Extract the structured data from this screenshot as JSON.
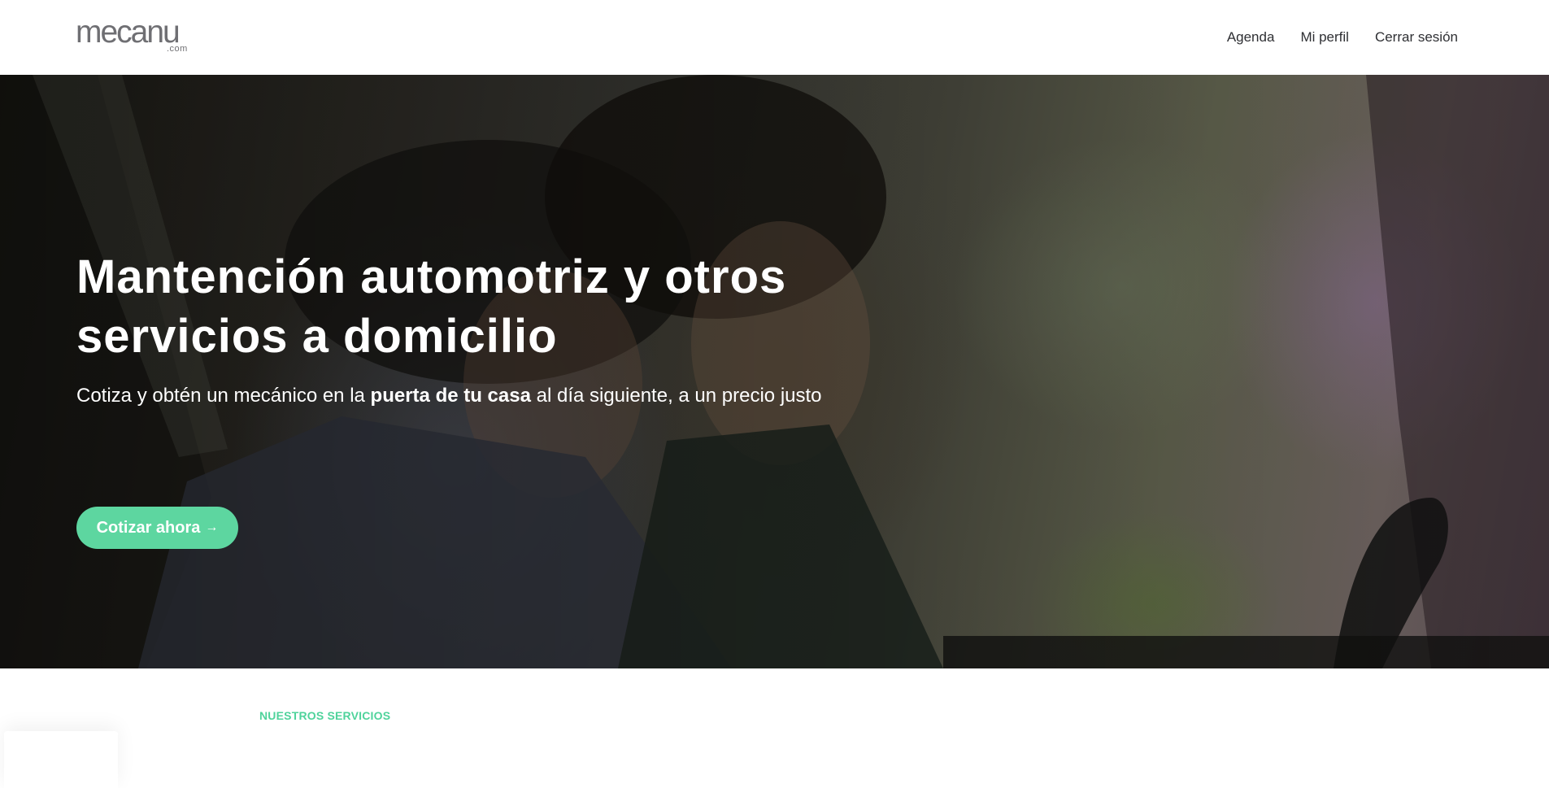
{
  "header": {
    "logo_main": "mecanu",
    "logo_sub": ".com",
    "nav": [
      {
        "label": "Agenda"
      },
      {
        "label": "Mi perfil"
      },
      {
        "label": "Cerrar sesión"
      }
    ]
  },
  "hero": {
    "title": "Mantención automotriz y otros servicios a domicilio",
    "subtitle_before": "Cotiza y obtén un mecánico en la ",
    "subtitle_bold": "puerta de tu casa",
    "subtitle_after": " al día siguiente, a un precio justo",
    "cta_label": "Cotizar ahora",
    "cta_icon": "arrow-right-icon"
  },
  "services": {
    "label": "NUESTROS SERVICIOS"
  },
  "colors": {
    "accent": "#5dd6a0",
    "accent_text": "#4fd39b",
    "nav_text": "#2e2f33",
    "logo": "#6f6f73"
  }
}
